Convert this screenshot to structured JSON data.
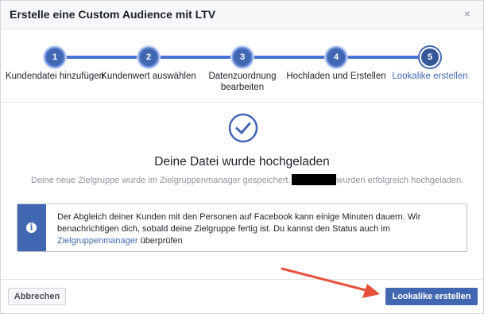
{
  "dialog": {
    "title": "Erstelle eine Custom Audience mit LTV",
    "close_symbol": "×"
  },
  "steps": [
    {
      "number": "1",
      "label": "Kundendatei hinzufügen"
    },
    {
      "number": "2",
      "label": "Kundenwert auswählen"
    },
    {
      "number": "3",
      "label_line1": "Datenzuordnung",
      "label_line2": "bearbeiten"
    },
    {
      "number": "4",
      "label": "Hochladen und Erstellen"
    },
    {
      "number": "5",
      "label": "Lookalike erstellen",
      "active": true
    }
  ],
  "success": {
    "title": "Deine Datei wurde hochgeladen",
    "subtitle_before": "Deine neue Zielgruppe wurde im Zielgruppenmanager gespeichert.",
    "subtitle_after": "wurden erfolgreich hochgeladen."
  },
  "info": {
    "icon": "info-icon",
    "text": "Der Abgleich deiner Kunden mit den Personen auf Facebook kann einige Minuten dauern. Wir benachrichtigen dich, sobald deine Zielgruppe fertig ist. Du kannst den Status auch im",
    "link": "Zielgruppenmanager",
    "text_after": " überprüfen"
  },
  "footer": {
    "cancel_label": "Abbrechen",
    "primary_label": "Lookalike erstellen"
  },
  "colors": {
    "accent": "#4267b2",
    "arrow": "#e8503a"
  }
}
